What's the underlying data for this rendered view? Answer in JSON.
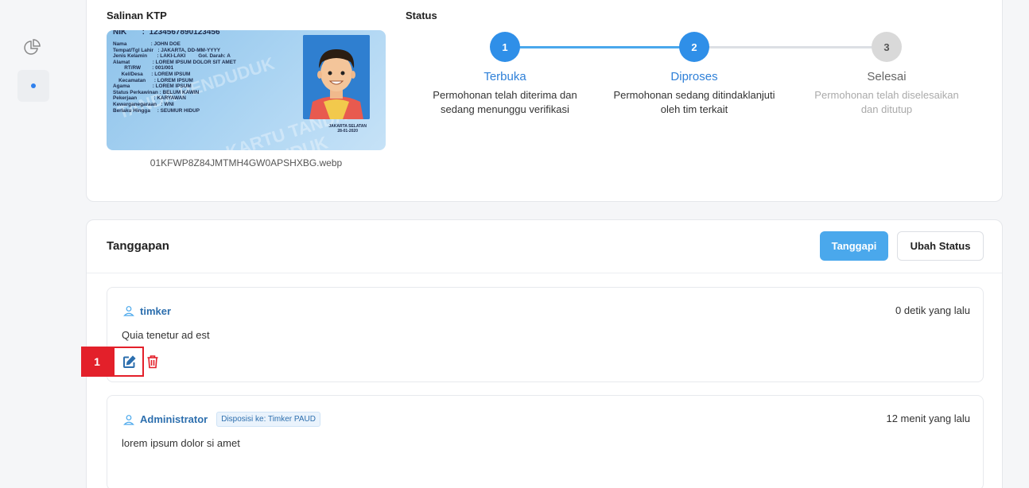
{
  "sidebar": {
    "icons": [
      "pie-chart-icon",
      "dot-icon"
    ]
  },
  "ktp_section": {
    "label": "Salinan KTP",
    "filename": "01KFWP8Z84JMTMH4GW0APSHXBG.webp",
    "card": {
      "nik_line": "NIK       :  1234567890123456",
      "lines": "Nama                 : JOHN DOE\nTempat/Tgl Lahir   : JAKARTA, DD-MM-YYYY\nJenis Kelamin       : LAKI-LAKI         Gol. Darah: A\nAlamat                : LOREM IPSUM DOLOR SIT AMET\n        RT/RW        : 001/001\n      Kel/Desa      : LOREM IPSUM\n    Kecamatan      : LOREM IPSUM\nAgama                : LOREM IPSUM\nStatus Perkawinan : BELUM KAWIN\nPekerjaan            : KARYAWAN\nKewarganegaraan   : WNI\nBerlaku Hingga     : SEUMUR HIDUP",
      "place": "JAKARTA SELATAN",
      "date": "28-01-2020"
    }
  },
  "status_section": {
    "label": "Status",
    "steps": [
      {
        "number": "1",
        "title": "Terbuka",
        "desc1": "Permohonan telah diterima dan",
        "desc2": "sedang menunggu verifikasi"
      },
      {
        "number": "2",
        "title": "Diproses",
        "desc1": "Permohonan sedang ditindaklanjuti",
        "desc2": "oleh tim terkait"
      },
      {
        "number": "3",
        "title": "Selesai",
        "desc1": "Permohonan telah diselesaikan",
        "desc2": "dan ditutup"
      }
    ]
  },
  "responses": {
    "title": "Tanggapan",
    "respond_label": "Tanggapi",
    "change_status_label": "Ubah Status",
    "items": [
      {
        "author": "timker",
        "time": "0 detik yang lalu",
        "message": "Quia tenetur ad est"
      },
      {
        "author": "Administrator",
        "badge": "Disposisi ke: Timker PAUD",
        "time": "12 menit yang lalu",
        "message": "lorem ipsum dolor si amet"
      }
    ]
  },
  "annotation": {
    "marker": "1"
  },
  "colors": {
    "primary": "#4aa8ec",
    "link": "#2d6fae",
    "danger": "#e3202a",
    "inactive": "#d9d9d9"
  }
}
